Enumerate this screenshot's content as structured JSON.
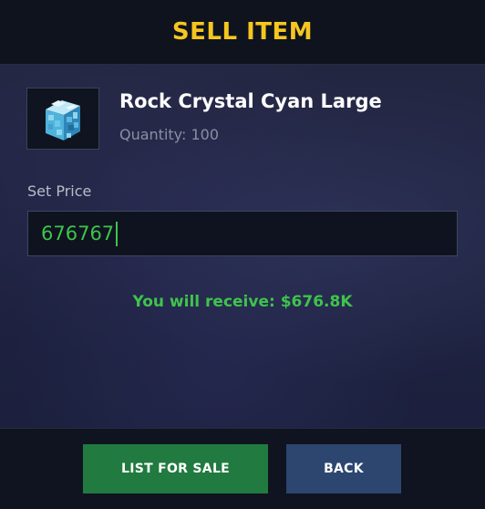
{
  "dialog": {
    "title": "SELL ITEM"
  },
  "item": {
    "name": "Rock Crystal Cyan Large",
    "quantity_text": "Quantity: 100",
    "icon": "cyan-crystal-block-icon"
  },
  "price": {
    "label": "Set Price",
    "value": "676767"
  },
  "receive_text": "You will receive: $676.8K",
  "buttons": {
    "list_for_sale": "LIST FOR SALE",
    "back": "BACK"
  },
  "colors": {
    "title": "#f6c620",
    "accent_green": "#3fc34c",
    "sell_button": "#217a3f",
    "back_button": "#2c4670"
  }
}
